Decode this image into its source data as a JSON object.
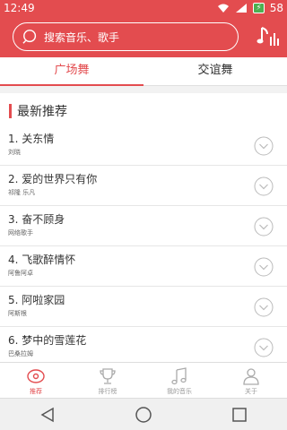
{
  "status_bar": {
    "time": "12:49",
    "battery": "58"
  },
  "header": {
    "search_placeholder": "搜索音乐、歌手",
    "music_icon": "music-note-icon"
  },
  "tabs": [
    {
      "label": "广场舞",
      "active": true
    },
    {
      "label": "交谊舞",
      "active": false
    }
  ],
  "section": {
    "title": "最新推荐"
  },
  "songs": [
    {
      "title": "1. 关东情",
      "artist": "刘晓"
    },
    {
      "title": "2. 爱的世界只有你",
      "artist": "祁隆 乐凡"
    },
    {
      "title": "3. 奋不顾身",
      "artist": "网络歌手"
    },
    {
      "title": "4. 飞歌醉情怀",
      "artist": "阿鲁阿卓"
    },
    {
      "title": "5. 阿啦家园",
      "artist": "阿斯根"
    },
    {
      "title": "6. 梦中的雪莲花",
      "artist": "巴桑拉姆"
    }
  ],
  "bottom_nav": [
    {
      "label": "推荐",
      "icon": "recommend-icon",
      "active": true
    },
    {
      "label": "排行榜",
      "icon": "trophy-icon",
      "active": false
    },
    {
      "label": "我的音乐",
      "icon": "music-notes-icon",
      "active": false
    },
    {
      "label": "关于",
      "icon": "user-icon",
      "active": false
    }
  ],
  "colors": {
    "accent": "#e34c4f",
    "text": "#333333",
    "muted": "#999999"
  }
}
